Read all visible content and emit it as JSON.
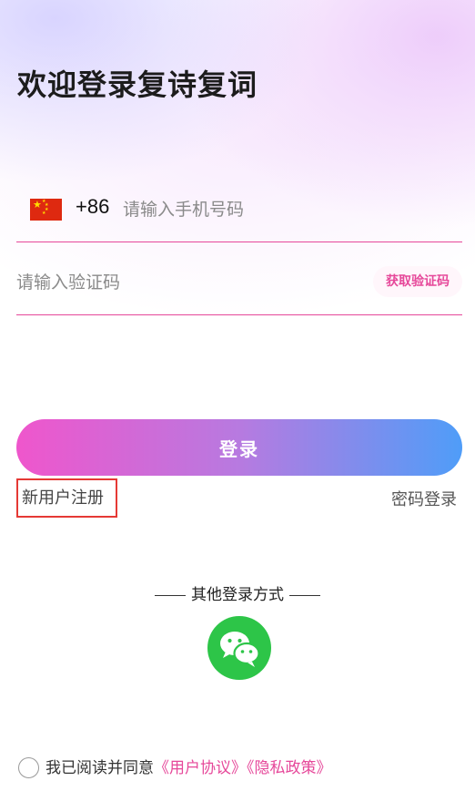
{
  "header": {
    "title": "欢迎登录复诗复词"
  },
  "phone": {
    "country_code": "+86",
    "placeholder": "请输入手机号码",
    "value": "",
    "flag_icon": "china-flag-icon"
  },
  "code": {
    "placeholder": "请输入验证码",
    "value": "",
    "get_code_label": "获取验证码"
  },
  "actions": {
    "login_label": "登录",
    "register_label": "新用户注册",
    "password_login_label": "密码登录"
  },
  "other_login": {
    "label": "其他登录方式",
    "wechat_icon": "wechat-icon"
  },
  "agreement": {
    "prefix": "我已阅读并同意",
    "user_agreement": "《用户协议》",
    "privacy_policy": "《隐私政策》",
    "checked": false
  },
  "colors": {
    "accent": "#e6489a",
    "gradient_start": "#ef56cc",
    "gradient_end": "#4f9df8",
    "wechat_green": "#2dc548",
    "highlight_border": "#e53935"
  }
}
